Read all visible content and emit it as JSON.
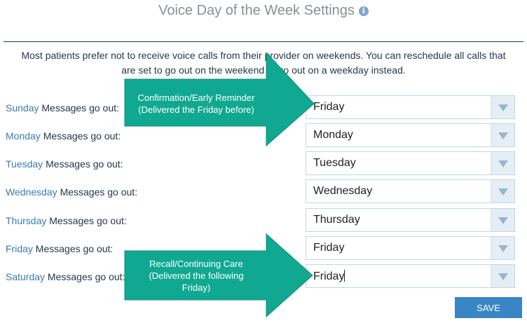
{
  "page": {
    "title": "Voice Day of the Week Settings",
    "info_icon": "info-icon",
    "description_line1": "Most patients prefer not to receive voice calls from their provider on weekends. You can reschedule all calls that",
    "description_line2": "are set to go out on the weekend to go out on a weekday instead."
  },
  "rows": [
    {
      "day": "Sunday",
      "suffix": " Messages go out:",
      "selected": "Friday"
    },
    {
      "day": "Monday",
      "suffix": " Messages go out:",
      "selected": "Monday"
    },
    {
      "day": "Tuesday",
      "suffix": " Messages go out:",
      "selected": "Tuesday"
    },
    {
      "day": "Wednesday",
      "suffix": " Messages go out:",
      "selected": "Wednesday"
    },
    {
      "day": "Thursday",
      "suffix": " Messages go out:",
      "selected": "Thursday"
    },
    {
      "day": "Friday",
      "suffix": " Messages go out:",
      "selected": "Friday"
    },
    {
      "day": "Saturday",
      "suffix": " Messages go out:",
      "selected": "Friday"
    }
  ],
  "save_label": "SAVE",
  "callouts": [
    {
      "line1": "Confirmation/Early Reminder",
      "line2": "(Delivered the Friday before)"
    },
    {
      "line1": "Recall/Continuing Care",
      "line2": "(Delivered the following",
      "line3": "Friday)"
    }
  ],
  "colors": {
    "arrow": "#11a891",
    "accent": "#3a86c4",
    "day_label": "#3a7bb0",
    "text": "#23384e"
  }
}
